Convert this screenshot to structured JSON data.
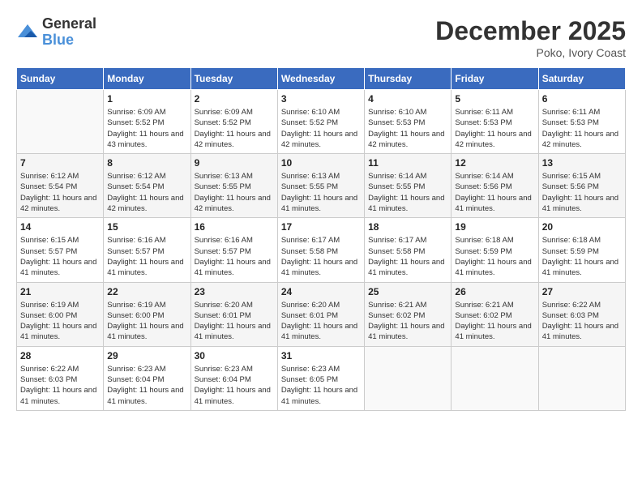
{
  "logo": {
    "text_general": "General",
    "text_blue": "Blue"
  },
  "header": {
    "month": "December 2025",
    "location": "Poko, Ivory Coast"
  },
  "weekdays": [
    "Sunday",
    "Monday",
    "Tuesday",
    "Wednesday",
    "Thursday",
    "Friday",
    "Saturday"
  ],
  "weeks": [
    [
      {
        "day": "",
        "sunrise": "",
        "sunset": "",
        "daylight": ""
      },
      {
        "day": "1",
        "sunrise": "6:09 AM",
        "sunset": "5:52 PM",
        "daylight": "11 hours and 43 minutes."
      },
      {
        "day": "2",
        "sunrise": "6:09 AM",
        "sunset": "5:52 PM",
        "daylight": "11 hours and 42 minutes."
      },
      {
        "day": "3",
        "sunrise": "6:10 AM",
        "sunset": "5:52 PM",
        "daylight": "11 hours and 42 minutes."
      },
      {
        "day": "4",
        "sunrise": "6:10 AM",
        "sunset": "5:53 PM",
        "daylight": "11 hours and 42 minutes."
      },
      {
        "day": "5",
        "sunrise": "6:11 AM",
        "sunset": "5:53 PM",
        "daylight": "11 hours and 42 minutes."
      },
      {
        "day": "6",
        "sunrise": "6:11 AM",
        "sunset": "5:53 PM",
        "daylight": "11 hours and 42 minutes."
      }
    ],
    [
      {
        "day": "7",
        "sunrise": "6:12 AM",
        "sunset": "5:54 PM",
        "daylight": "11 hours and 42 minutes."
      },
      {
        "day": "8",
        "sunrise": "6:12 AM",
        "sunset": "5:54 PM",
        "daylight": "11 hours and 42 minutes."
      },
      {
        "day": "9",
        "sunrise": "6:13 AM",
        "sunset": "5:55 PM",
        "daylight": "11 hours and 42 minutes."
      },
      {
        "day": "10",
        "sunrise": "6:13 AM",
        "sunset": "5:55 PM",
        "daylight": "11 hours and 41 minutes."
      },
      {
        "day": "11",
        "sunrise": "6:14 AM",
        "sunset": "5:55 PM",
        "daylight": "11 hours and 41 minutes."
      },
      {
        "day": "12",
        "sunrise": "6:14 AM",
        "sunset": "5:56 PM",
        "daylight": "11 hours and 41 minutes."
      },
      {
        "day": "13",
        "sunrise": "6:15 AM",
        "sunset": "5:56 PM",
        "daylight": "11 hours and 41 minutes."
      }
    ],
    [
      {
        "day": "14",
        "sunrise": "6:15 AM",
        "sunset": "5:57 PM",
        "daylight": "11 hours and 41 minutes."
      },
      {
        "day": "15",
        "sunrise": "6:16 AM",
        "sunset": "5:57 PM",
        "daylight": "11 hours and 41 minutes."
      },
      {
        "day": "16",
        "sunrise": "6:16 AM",
        "sunset": "5:57 PM",
        "daylight": "11 hours and 41 minutes."
      },
      {
        "day": "17",
        "sunrise": "6:17 AM",
        "sunset": "5:58 PM",
        "daylight": "11 hours and 41 minutes."
      },
      {
        "day": "18",
        "sunrise": "6:17 AM",
        "sunset": "5:58 PM",
        "daylight": "11 hours and 41 minutes."
      },
      {
        "day": "19",
        "sunrise": "6:18 AM",
        "sunset": "5:59 PM",
        "daylight": "11 hours and 41 minutes."
      },
      {
        "day": "20",
        "sunrise": "6:18 AM",
        "sunset": "5:59 PM",
        "daylight": "11 hours and 41 minutes."
      }
    ],
    [
      {
        "day": "21",
        "sunrise": "6:19 AM",
        "sunset": "6:00 PM",
        "daylight": "11 hours and 41 minutes."
      },
      {
        "day": "22",
        "sunrise": "6:19 AM",
        "sunset": "6:00 PM",
        "daylight": "11 hours and 41 minutes."
      },
      {
        "day": "23",
        "sunrise": "6:20 AM",
        "sunset": "6:01 PM",
        "daylight": "11 hours and 41 minutes."
      },
      {
        "day": "24",
        "sunrise": "6:20 AM",
        "sunset": "6:01 PM",
        "daylight": "11 hours and 41 minutes."
      },
      {
        "day": "25",
        "sunrise": "6:21 AM",
        "sunset": "6:02 PM",
        "daylight": "11 hours and 41 minutes."
      },
      {
        "day": "26",
        "sunrise": "6:21 AM",
        "sunset": "6:02 PM",
        "daylight": "11 hours and 41 minutes."
      },
      {
        "day": "27",
        "sunrise": "6:22 AM",
        "sunset": "6:03 PM",
        "daylight": "11 hours and 41 minutes."
      }
    ],
    [
      {
        "day": "28",
        "sunrise": "6:22 AM",
        "sunset": "6:03 PM",
        "daylight": "11 hours and 41 minutes."
      },
      {
        "day": "29",
        "sunrise": "6:23 AM",
        "sunset": "6:04 PM",
        "daylight": "11 hours and 41 minutes."
      },
      {
        "day": "30",
        "sunrise": "6:23 AM",
        "sunset": "6:04 PM",
        "daylight": "11 hours and 41 minutes."
      },
      {
        "day": "31",
        "sunrise": "6:23 AM",
        "sunset": "6:05 PM",
        "daylight": "11 hours and 41 minutes."
      },
      {
        "day": "",
        "sunrise": "",
        "sunset": "",
        "daylight": ""
      },
      {
        "day": "",
        "sunrise": "",
        "sunset": "",
        "daylight": ""
      },
      {
        "day": "",
        "sunrise": "",
        "sunset": "",
        "daylight": ""
      }
    ]
  ],
  "labels": {
    "sunrise_prefix": "Sunrise: ",
    "sunset_prefix": "Sunset: ",
    "daylight_prefix": "Daylight: "
  }
}
